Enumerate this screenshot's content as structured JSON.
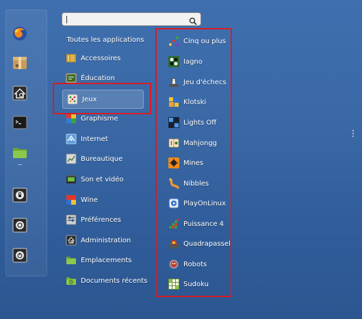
{
  "search": {
    "value": "",
    "placeholder": ""
  },
  "favorites": [
    {
      "name": "firefox-icon"
    },
    {
      "name": "package-icon"
    },
    {
      "name": "settings-icon"
    },
    {
      "name": "terminal-icon"
    },
    {
      "name": "folder-icon"
    },
    {
      "name": "lock-screen-icon"
    },
    {
      "name": "logout-icon"
    },
    {
      "name": "shutdown-icon"
    }
  ],
  "categories": [
    {
      "label": "Toutes les applications",
      "active": false
    },
    {
      "label": "Accessoires",
      "active": false
    },
    {
      "label": "Éducation",
      "active": false
    },
    {
      "label": "Jeux",
      "active": true
    },
    {
      "label": "Graphisme",
      "active": false
    },
    {
      "label": "Internet",
      "active": false
    },
    {
      "label": "Bureautique",
      "active": false
    },
    {
      "label": "Son et vidéo",
      "active": false
    },
    {
      "label": "Wine",
      "active": false
    },
    {
      "label": "Préférences",
      "active": false
    },
    {
      "label": "Administration",
      "active": false
    },
    {
      "label": "Emplacements",
      "active": false
    },
    {
      "label": "Documents récents",
      "active": false
    }
  ],
  "apps": [
    {
      "label": "Cinq ou plus"
    },
    {
      "label": "Iagno"
    },
    {
      "label": "Jeu d'échecs"
    },
    {
      "label": "Klotski"
    },
    {
      "label": "Lights Off"
    },
    {
      "label": "Mahjongg"
    },
    {
      "label": "Mines"
    },
    {
      "label": "Nibbles"
    },
    {
      "label": "PlayOnLinux"
    },
    {
      "label": "Puissance 4"
    },
    {
      "label": "Quadrapassel"
    },
    {
      "label": "Robots"
    },
    {
      "label": "Sudoku"
    }
  ],
  "colors": {
    "highlight_border": "#d81c24",
    "background": "#3a68a5",
    "text": "#ffffff"
  }
}
